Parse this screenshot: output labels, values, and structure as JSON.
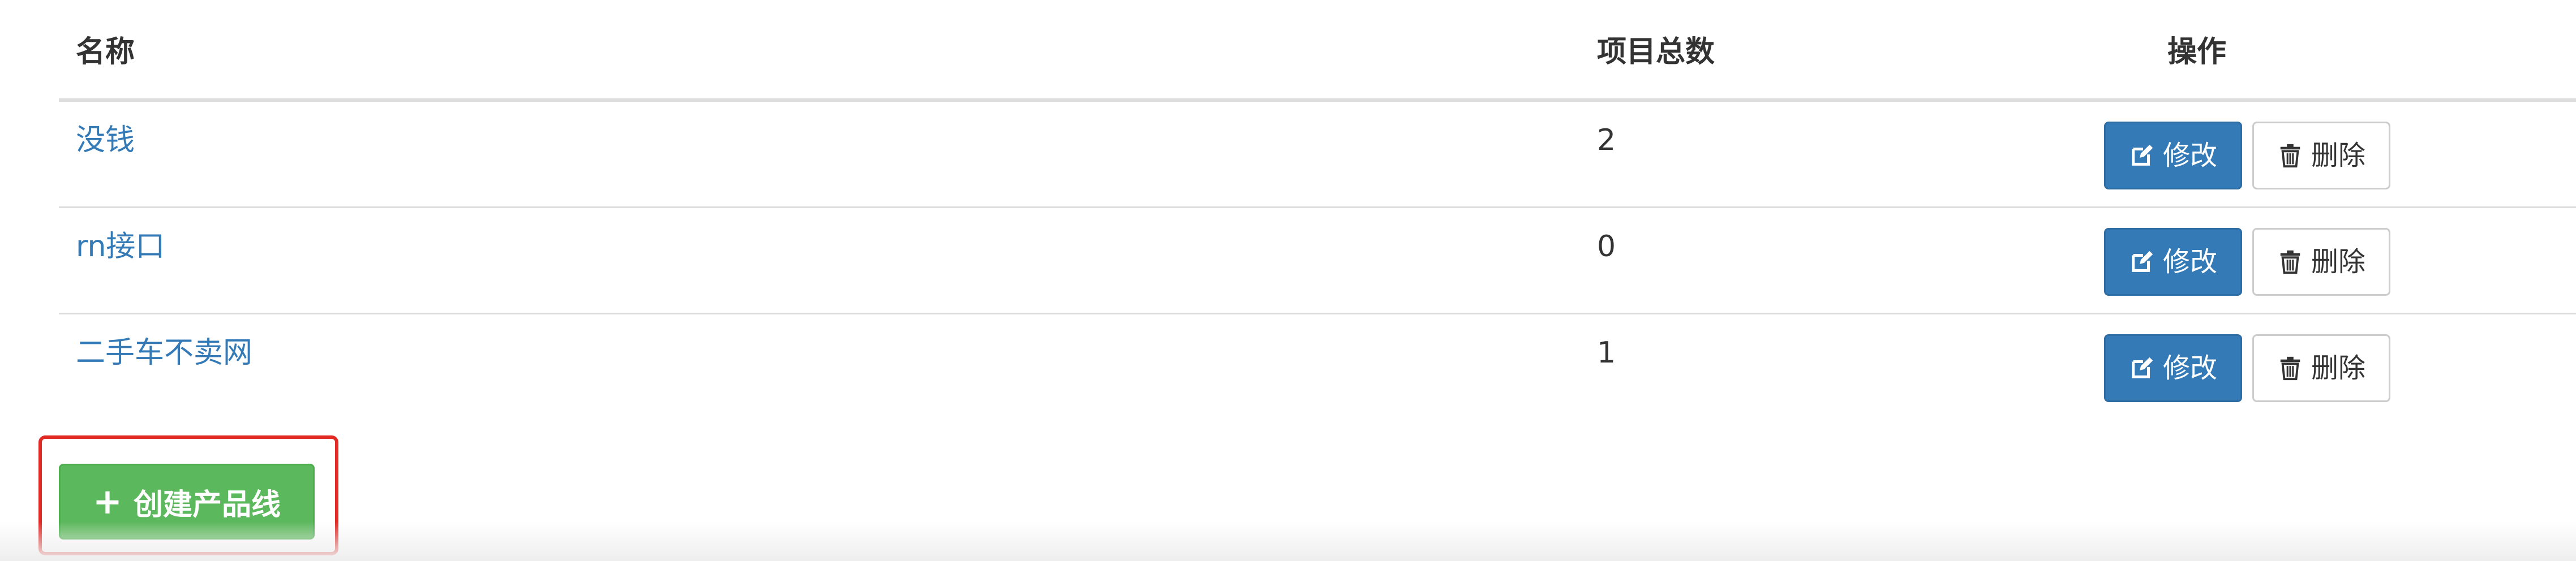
{
  "table": {
    "headers": {
      "name": "名称",
      "count": "项目总数",
      "ops": "操作"
    },
    "rows": [
      {
        "name": "没钱",
        "count": "2"
      },
      {
        "name": "rn接口",
        "count": "0"
      },
      {
        "name": "二手车不卖网",
        "count": "1"
      }
    ],
    "edit_label": "修改",
    "delete_label": "删除"
  },
  "create_button": {
    "label": "创建产品线",
    "highlight_color": "#e02b27"
  },
  "colors": {
    "link": "#337ab7",
    "primary": "#337ab7",
    "success": "#5cb85c"
  },
  "icons": {
    "edit": "edit-icon",
    "delete": "trash-icon",
    "create": "plus-icon"
  }
}
